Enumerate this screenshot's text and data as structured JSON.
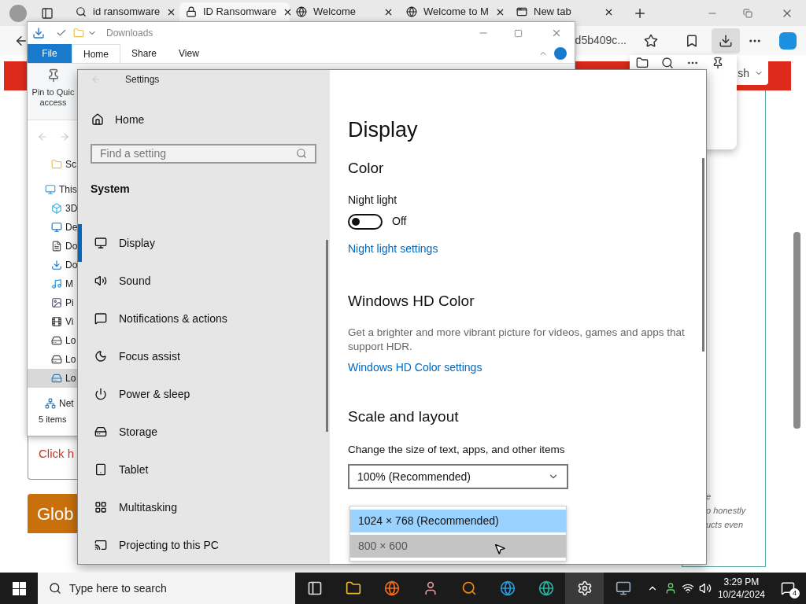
{
  "browser": {
    "tabs": [
      {
        "label": "id ransomware",
        "selected": false
      },
      {
        "label": "ID Ransomware",
        "selected": true
      },
      {
        "label": "Welcome",
        "selected": false
      },
      {
        "label": "Welcome to M",
        "selected": false
      },
      {
        "label": "New tab",
        "selected": false
      }
    ],
    "address_fragment": "d5b409c...",
    "page": {
      "header_button": "sh",
      "link_text": "Click h",
      "banner": "Glob",
      "side_text": [
        "e",
        "o honestly",
        "ucts even"
      ]
    }
  },
  "explorer": {
    "title": "Downloads",
    "ribbon_tabs": [
      {
        "label": "File",
        "selected": false
      },
      {
        "label": "Home",
        "selected": true
      },
      {
        "label": "Share",
        "selected": false
      },
      {
        "label": "View",
        "selected": false
      }
    ],
    "pin_button": "Pin to Quic\naccess",
    "tree": [
      {
        "label": "Sc",
        "selected": false
      },
      {
        "label": "This",
        "selected": false
      },
      {
        "label": "3D",
        "selected": false
      },
      {
        "label": "De",
        "selected": false
      },
      {
        "label": "Do",
        "selected": false
      },
      {
        "label": "Do",
        "selected": false
      },
      {
        "label": "M",
        "selected": false
      },
      {
        "label": "Pi",
        "selected": false
      },
      {
        "label": "Vi",
        "selected": false
      },
      {
        "label": "Lo",
        "selected": false
      },
      {
        "label": "Lo",
        "selected": false
      },
      {
        "label": "Lo",
        "selected": true
      },
      {
        "label": "Net",
        "selected": false
      }
    ],
    "status": "5 items"
  },
  "settings": {
    "title": "Settings",
    "home": "Home",
    "search_placeholder": "Find a setting",
    "section": "System",
    "nav": [
      {
        "label": "Display",
        "selected": true
      },
      {
        "label": "Sound",
        "selected": false
      },
      {
        "label": "Notifications & actions",
        "selected": false
      },
      {
        "label": "Focus assist",
        "selected": false
      },
      {
        "label": "Power & sleep",
        "selected": false
      },
      {
        "label": "Storage",
        "selected": false
      },
      {
        "label": "Tablet",
        "selected": false
      },
      {
        "label": "Multitasking",
        "selected": false
      },
      {
        "label": "Projecting to this PC",
        "selected": false
      }
    ],
    "heading": "Display",
    "color_heading": "Color",
    "night_light": {
      "label": "Night light",
      "on": false,
      "state": "Off",
      "link": "Night light settings"
    },
    "hd_heading": "Windows HD Color",
    "hd_description": "Get a brighter and more vibrant picture for videos, games and apps that support HDR.",
    "hd_link": "Windows HD Color settings",
    "scale_heading": "Scale and layout",
    "scale_label": "Change the size of text, apps, and other items",
    "scale_value": "100% (Recommended)",
    "resolution_options": [
      {
        "label": "1024 × 768 (Recommended)",
        "selected": true,
        "hovered": false
      },
      {
        "label": "800 × 600",
        "selected": false,
        "hovered": true
      }
    ]
  },
  "taskbar": {
    "search_placeholder": "Type here to search",
    "apps": [
      {
        "selected": false
      },
      {
        "selected": false
      },
      {
        "selected": false
      },
      {
        "selected": false
      },
      {
        "selected": false
      },
      {
        "selected": false
      },
      {
        "selected": false
      },
      {
        "selected": true
      },
      {
        "selected": false
      }
    ],
    "time": "3:29 PM",
    "date": "10/24/2024",
    "notifications": "4"
  }
}
